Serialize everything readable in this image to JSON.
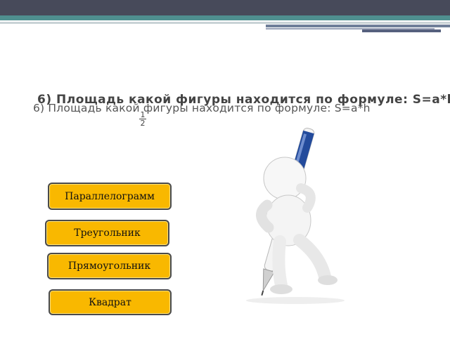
{
  "slide": {
    "title_back": "6) Площадь какой фигуры находится по формуле: S=",
    "title_back_tail": "a*h",
    "fraction_numerator": "1",
    "fraction_denominator": "2",
    "title_front": "6) Площадь какой фигуры находится по формуле: S=a*h"
  },
  "answers": [
    {
      "label": "Параллелограмм"
    },
    {
      "label": "Треугольник"
    },
    {
      "label": "Прямоугольник"
    },
    {
      "label": "Квадрат"
    }
  ],
  "colors": {
    "button_fill": "#f9b800",
    "button_border": "#4a4a4a",
    "topbar": "#474a5a",
    "accent": "#4f8f8f"
  },
  "illustration": {
    "icon": "figure-with-pen-icon"
  }
}
